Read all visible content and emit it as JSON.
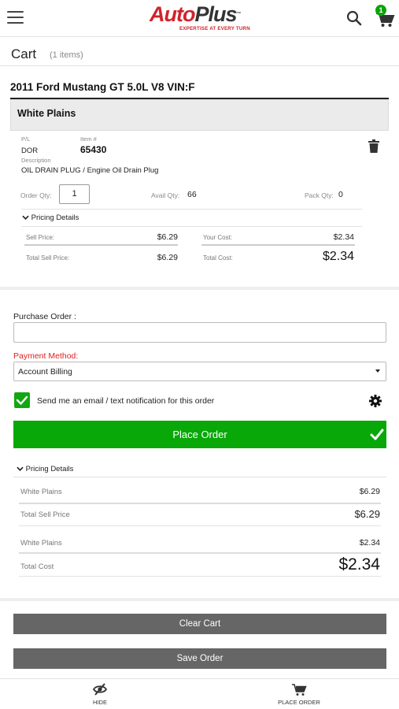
{
  "header": {
    "logo_auto": "Auto",
    "logo_plus": "Plus",
    "logo_tm": "™",
    "tagline": "EXPERTISE AT EVERY TURN",
    "cart_badge": "1"
  },
  "cart": {
    "title": "Cart",
    "count_label": "(1 items)"
  },
  "vehicle": "2011 Ford Mustang GT 5.0L V8 VIN:F",
  "store": "White Plains",
  "item": {
    "pl_label": "P/L",
    "pl_value": "DOR",
    "item_label": "Item #",
    "item_value": "65430",
    "desc_label": "Description",
    "desc_value": "OIL DRAIN PLUG / Engine Oil Drain Plug",
    "order_qty_label": "Order Qty:",
    "order_qty_value": "1",
    "avail_qty_label": "Avail Qty:",
    "avail_qty_value": "66",
    "pack_qty_label": "Pack Qty:",
    "pack_qty_value": "0",
    "pricing_label": "Pricing Details",
    "sell_price_label": "Sell Price:",
    "sell_price_value": "$6.29",
    "your_cost_label": "Your Cost:",
    "your_cost_value": "$2.34",
    "total_sell_label": "Total Sell Price:",
    "total_sell_value": "$6.29",
    "total_cost_label": "Total Cost:",
    "total_cost_value": "$2.34"
  },
  "order": {
    "po_label": "Purchase Order :",
    "po_value": "",
    "payment_label": "Payment Method:",
    "payment_value": "Account Billing",
    "notify_label": "Send me an email / text notification for this order",
    "notify_checked": true,
    "place_order_label": "Place Order"
  },
  "summary": {
    "toggle_label": "Pricing Details",
    "rows": [
      {
        "label": "White Plains",
        "value": "$6.29"
      },
      {
        "label": "Total Sell Price",
        "value": "$6.29"
      },
      {
        "label": "White Plains",
        "value": "$2.34"
      },
      {
        "label": "Total Cost",
        "value": "$2.34"
      }
    ]
  },
  "actions": {
    "clear_cart": "Clear Cart",
    "save_order": "Save Order"
  },
  "footer": {
    "hide_label": "HIDE",
    "place_order_label": "PLACE ORDER"
  },
  "colors": {
    "brand_red": "#d3222a",
    "success_green": "#08a808",
    "button_grey": "#666666",
    "payment_label_red": "#e02020"
  }
}
